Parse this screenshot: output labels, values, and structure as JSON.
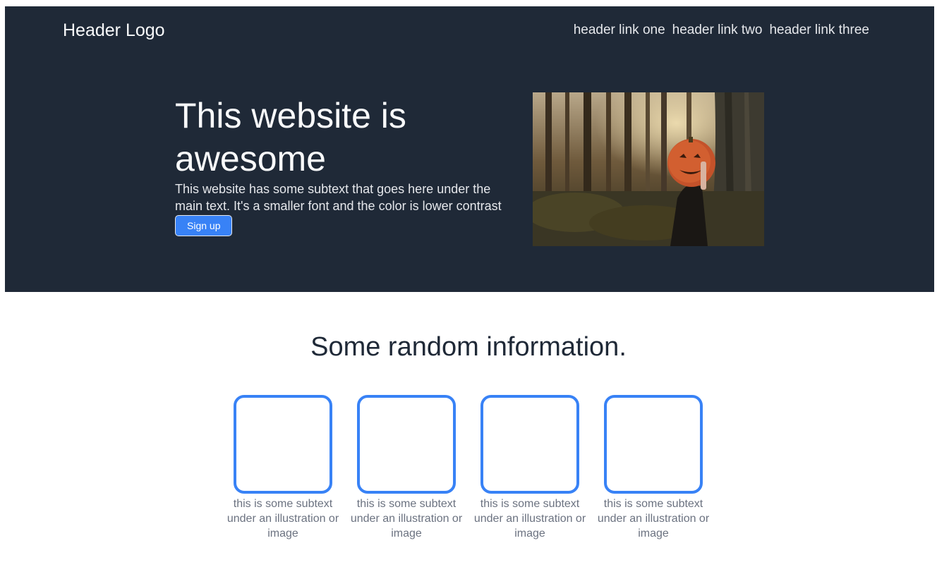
{
  "header": {
    "logo": "Header Logo",
    "links": [
      "header link one",
      "header link two",
      "header link three"
    ]
  },
  "hero": {
    "title": "This website is awesome",
    "subtext": "This website has some subtext that goes here under the main text. It's a smaller font and the color is lower contrast",
    "button_label": "Sign up",
    "image_icon": "forest-pumpkin-photo"
  },
  "info": {
    "title": "Some random information.",
    "cards": [
      {
        "text": "this is some subtext under an illustration or image"
      },
      {
        "text": "this is some subtext under an illustration or image"
      },
      {
        "text": "this is some subtext under an illustration or image"
      },
      {
        "text": "this is some subtext under an illustration or image"
      }
    ]
  },
  "colors": {
    "hero_bg": "#1f2937",
    "accent": "#3882f6",
    "card_text": "#6b7280"
  }
}
